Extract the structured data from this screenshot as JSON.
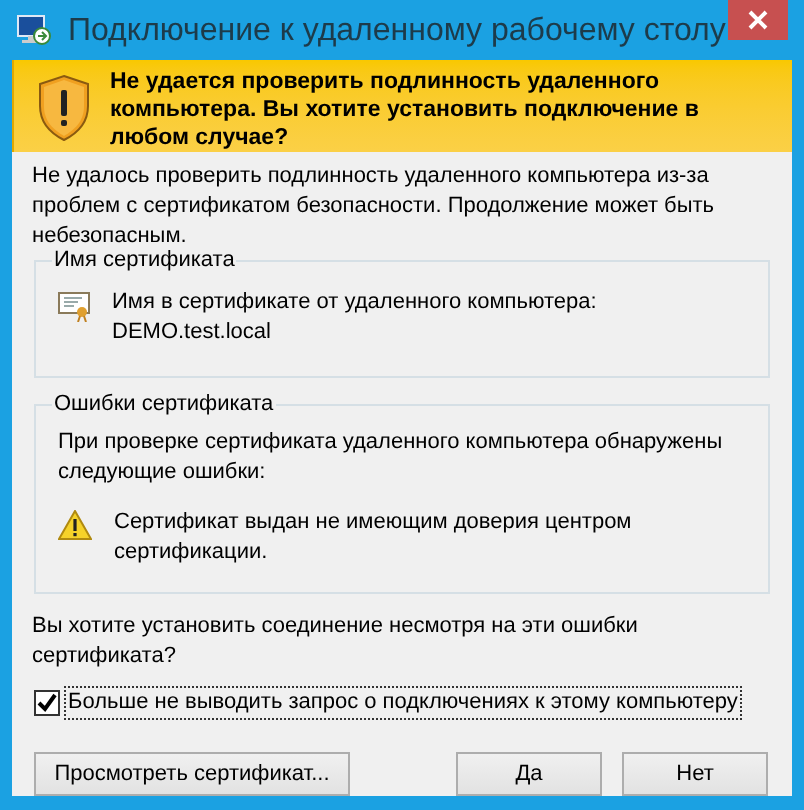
{
  "window": {
    "title": "Подключение к удаленному рабочему столу"
  },
  "warning_banner": {
    "text": "Не удается проверить подлинность удаленного компьютера. Вы хотите установить подключение в любом случае?"
  },
  "intro": "Не удалось проверить подлинность удаленного компьютера из-за проблем с сертификатом безопасности. Продолжение может быть небезопасным.",
  "groups": [
    {
      "legend": "Имя сертификата",
      "kind": "name",
      "lines": [
        "Имя в сертификате от удаленного компьютера:",
        "DEMO.test.local"
      ]
    },
    {
      "legend": "Ошибки сертификата",
      "kind": "errors",
      "description": "При проверке сертификата удаленного компьютера обнаружены следующие ошибки:",
      "errors": [
        "Сертификат выдан не имеющим доверия центром сертификации."
      ]
    }
  ],
  "question": "Вы хотите установить соединение несмотря на эти ошибки сертификата?",
  "checkbox": {
    "label": "Больше не выводить запрос о подключениях к этому компьютеру",
    "checked": true
  },
  "buttons": [
    {
      "label": "Просмотреть сертификат...",
      "kind": "left"
    },
    {
      "label": "Да",
      "kind": "right"
    },
    {
      "label": "Нет",
      "kind": "right"
    }
  ]
}
